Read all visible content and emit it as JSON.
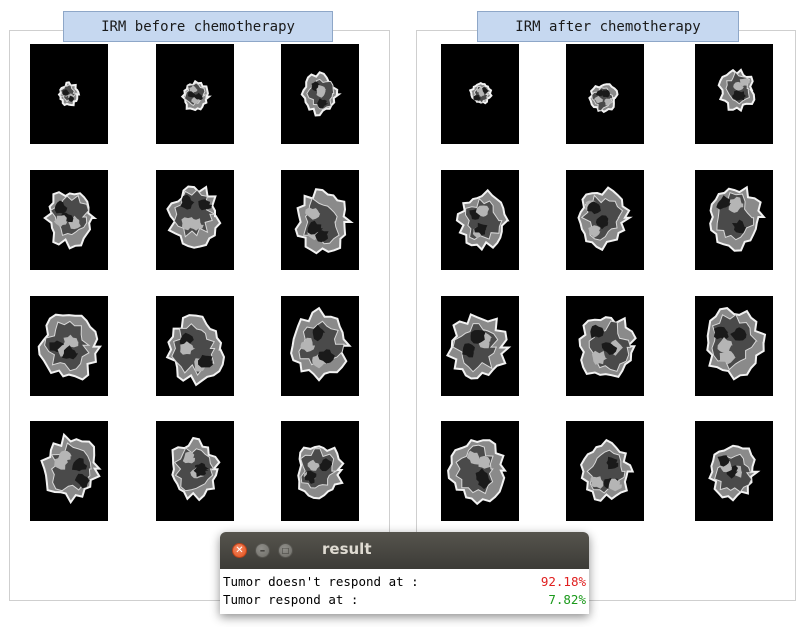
{
  "panels": {
    "before": {
      "title": "IRM before chemotherapy"
    },
    "after": {
      "title": "IRM after chemotherapy"
    }
  },
  "result_window": {
    "title": "result",
    "rows": [
      {
        "label": "Tumor doesn't respond at :",
        "value": "92.18%",
        "status_color": "#e02020"
      },
      {
        "label": "Tumor respond at :",
        "value": "7.82%",
        "status_color": "#1c9a1c"
      }
    ],
    "controls": [
      "close-icon",
      "minimize-icon",
      "maximize-icon"
    ]
  },
  "colors": {
    "panel_title_bg": "#c6d8f0",
    "titlebar_bg": "#3c3b37",
    "close_button": "#e95420"
  }
}
